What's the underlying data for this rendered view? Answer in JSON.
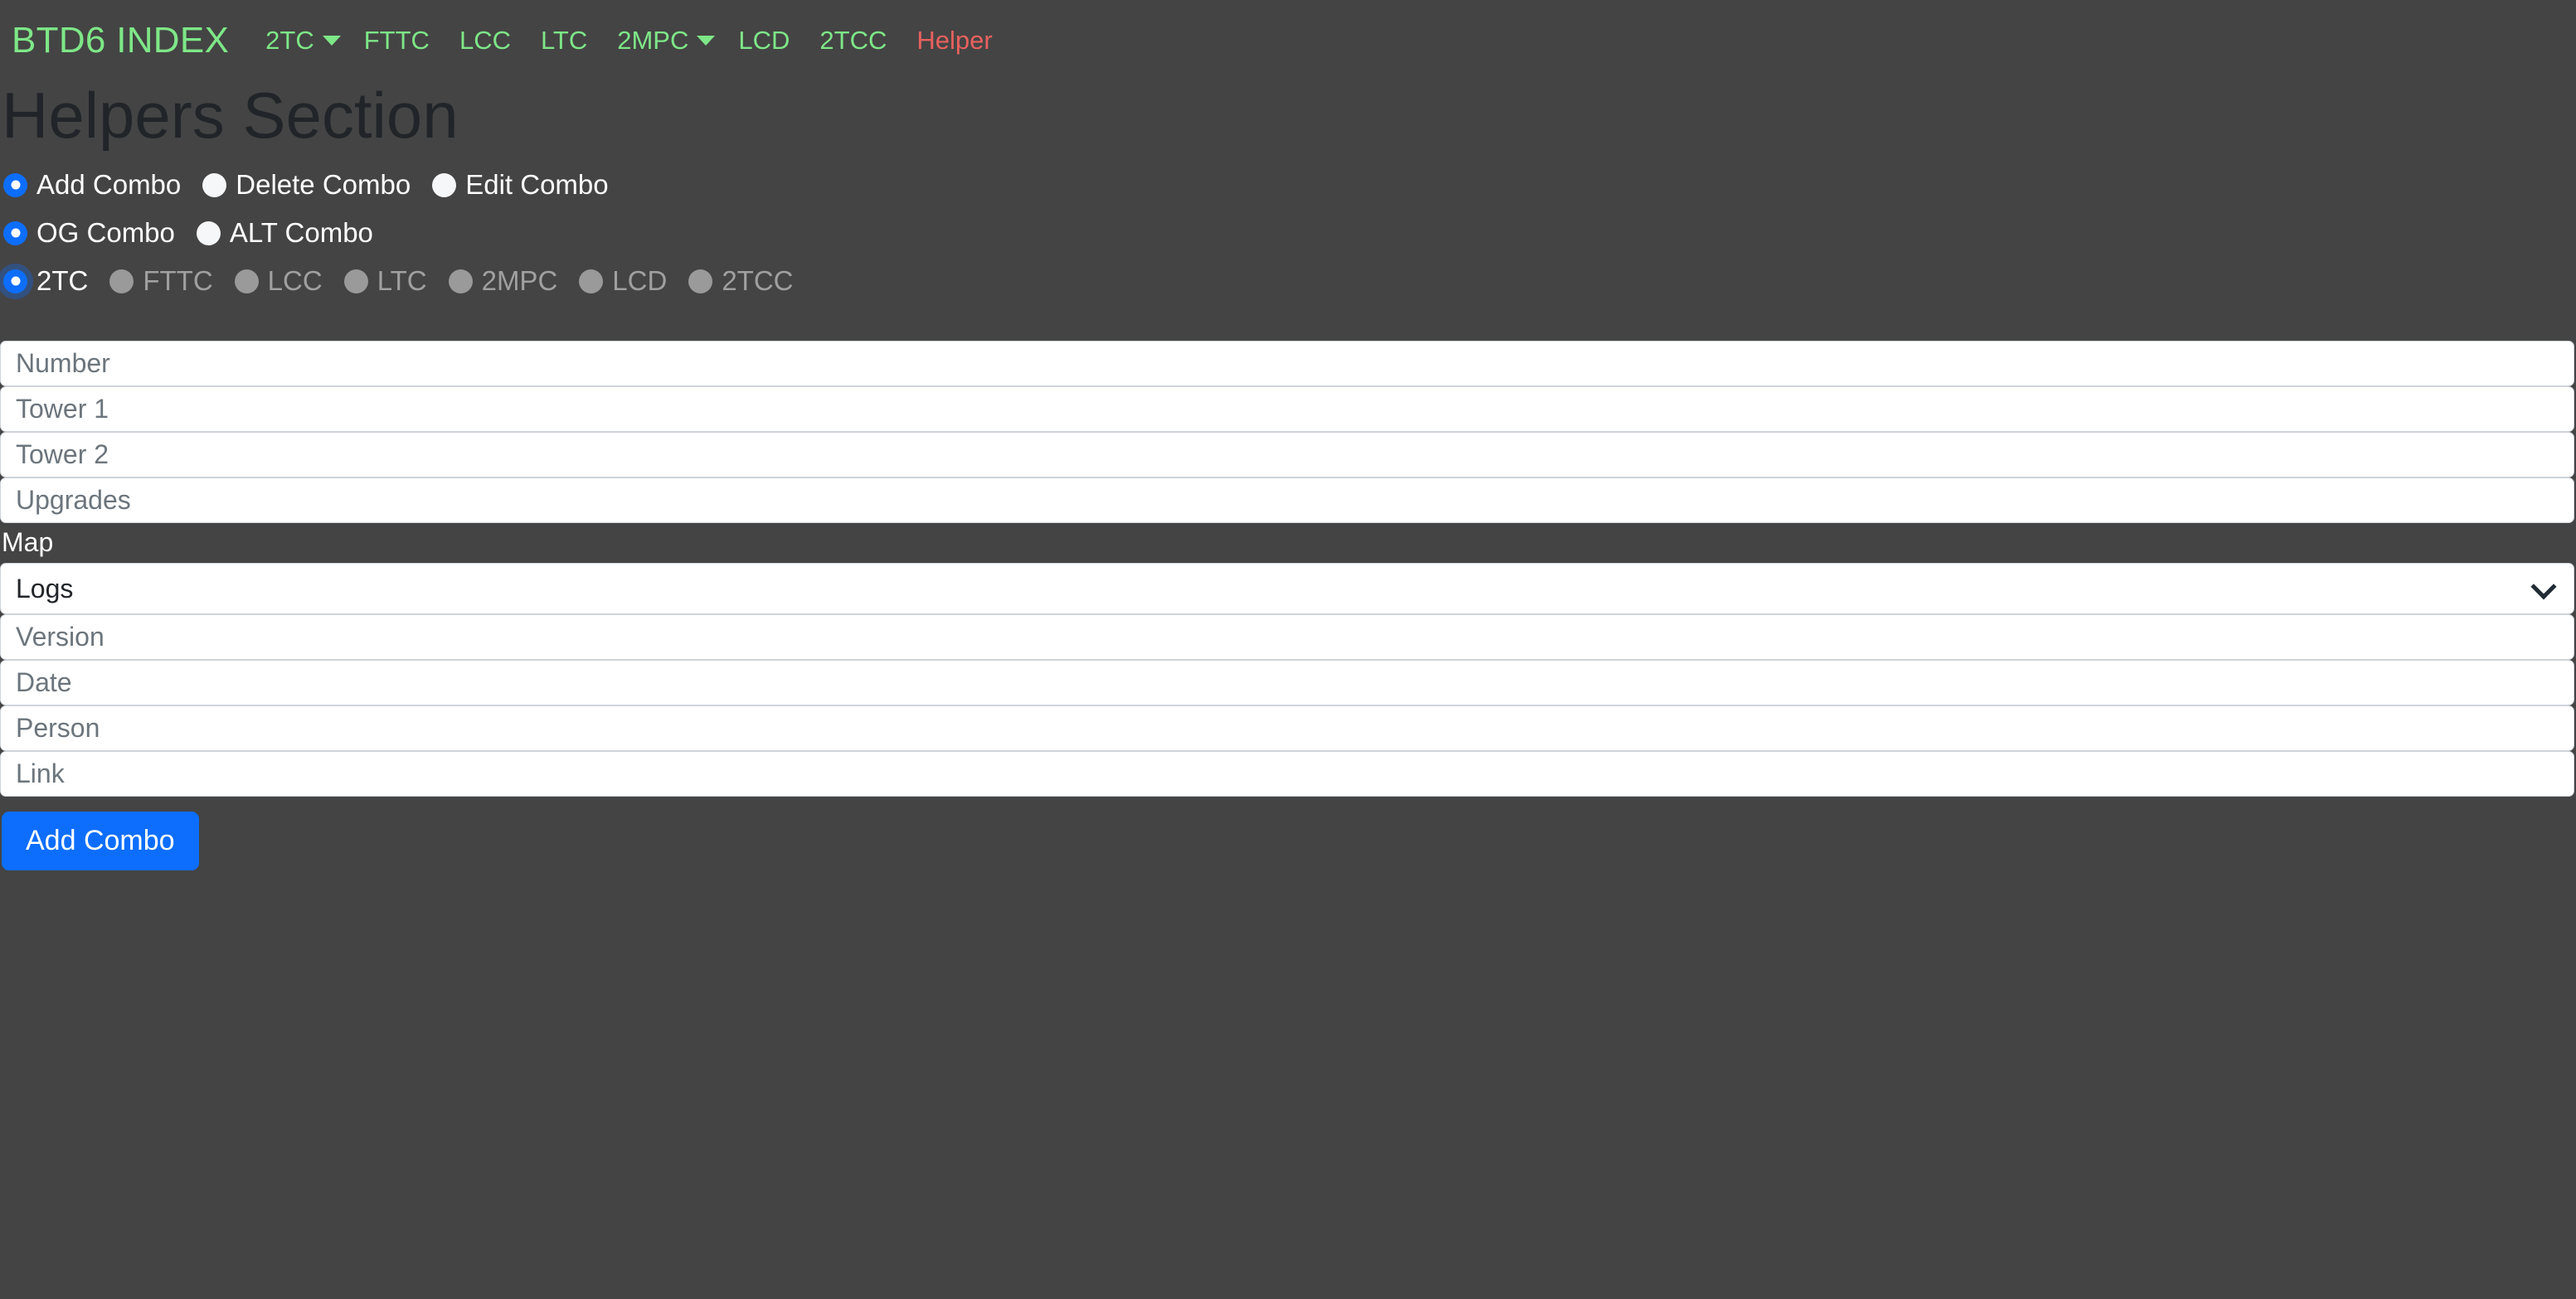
{
  "navbar": {
    "brand": "BTD6 INDEX",
    "items": [
      {
        "label": "2TC",
        "caret": true,
        "style": "normal"
      },
      {
        "label": "FTTC",
        "caret": false,
        "style": "normal"
      },
      {
        "label": "LCC",
        "caret": false,
        "style": "normal"
      },
      {
        "label": "LTC",
        "caret": false,
        "style": "normal"
      },
      {
        "label": "2MPC",
        "caret": true,
        "style": "normal"
      },
      {
        "label": "LCD",
        "caret": false,
        "style": "normal"
      },
      {
        "label": "2TCC",
        "caret": false,
        "style": "normal"
      },
      {
        "label": "Helper",
        "caret": false,
        "style": "danger"
      }
    ],
    "brand_color": "#7ee787",
    "danger_color": "#e8615f"
  },
  "page": {
    "title": "Helpers Section"
  },
  "action_radios": {
    "items": [
      {
        "label": "Add Combo",
        "checked": true,
        "disabled": false
      },
      {
        "label": "Delete Combo",
        "checked": false,
        "disabled": false
      },
      {
        "label": "Edit Combo",
        "checked": false,
        "disabled": false
      }
    ]
  },
  "combo_type_radios": {
    "items": [
      {
        "label": "OG Combo",
        "checked": true,
        "disabled": false
      },
      {
        "label": "ALT Combo",
        "checked": false,
        "disabled": false
      }
    ]
  },
  "category_radios": {
    "items": [
      {
        "label": "2TC",
        "checked": true,
        "disabled": false,
        "focused": true
      },
      {
        "label": "FTTC",
        "checked": false,
        "disabled": true,
        "focused": false
      },
      {
        "label": "LCC",
        "checked": false,
        "disabled": true,
        "focused": false
      },
      {
        "label": "LTC",
        "checked": false,
        "disabled": true,
        "focused": false
      },
      {
        "label": "2MPC",
        "checked": false,
        "disabled": true,
        "focused": false
      },
      {
        "label": "LCD",
        "checked": false,
        "disabled": true,
        "focused": false
      },
      {
        "label": "2TCC",
        "checked": false,
        "disabled": true,
        "focused": false
      }
    ]
  },
  "form": {
    "number": {
      "placeholder": "Number",
      "value": ""
    },
    "tower1": {
      "placeholder": "Tower 1",
      "value": ""
    },
    "tower2": {
      "placeholder": "Tower 2",
      "value": ""
    },
    "upgrades": {
      "placeholder": "Upgrades",
      "value": ""
    },
    "map_label": "Map",
    "map_select": {
      "selected": "Logs",
      "icon": "chevron-down-icon"
    },
    "version": {
      "placeholder": "Version",
      "value": ""
    },
    "date": {
      "placeholder": "Date",
      "value": ""
    },
    "person": {
      "placeholder": "Person",
      "value": ""
    },
    "link": {
      "placeholder": "Link",
      "value": ""
    },
    "submit_label": "Add Combo"
  },
  "colors": {
    "background": "#444444",
    "accent": "#0d6efd",
    "nav_green": "#7ee787",
    "nav_red": "#e8615f",
    "input_bg": "#ffffff",
    "placeholder": "#6c757d"
  }
}
